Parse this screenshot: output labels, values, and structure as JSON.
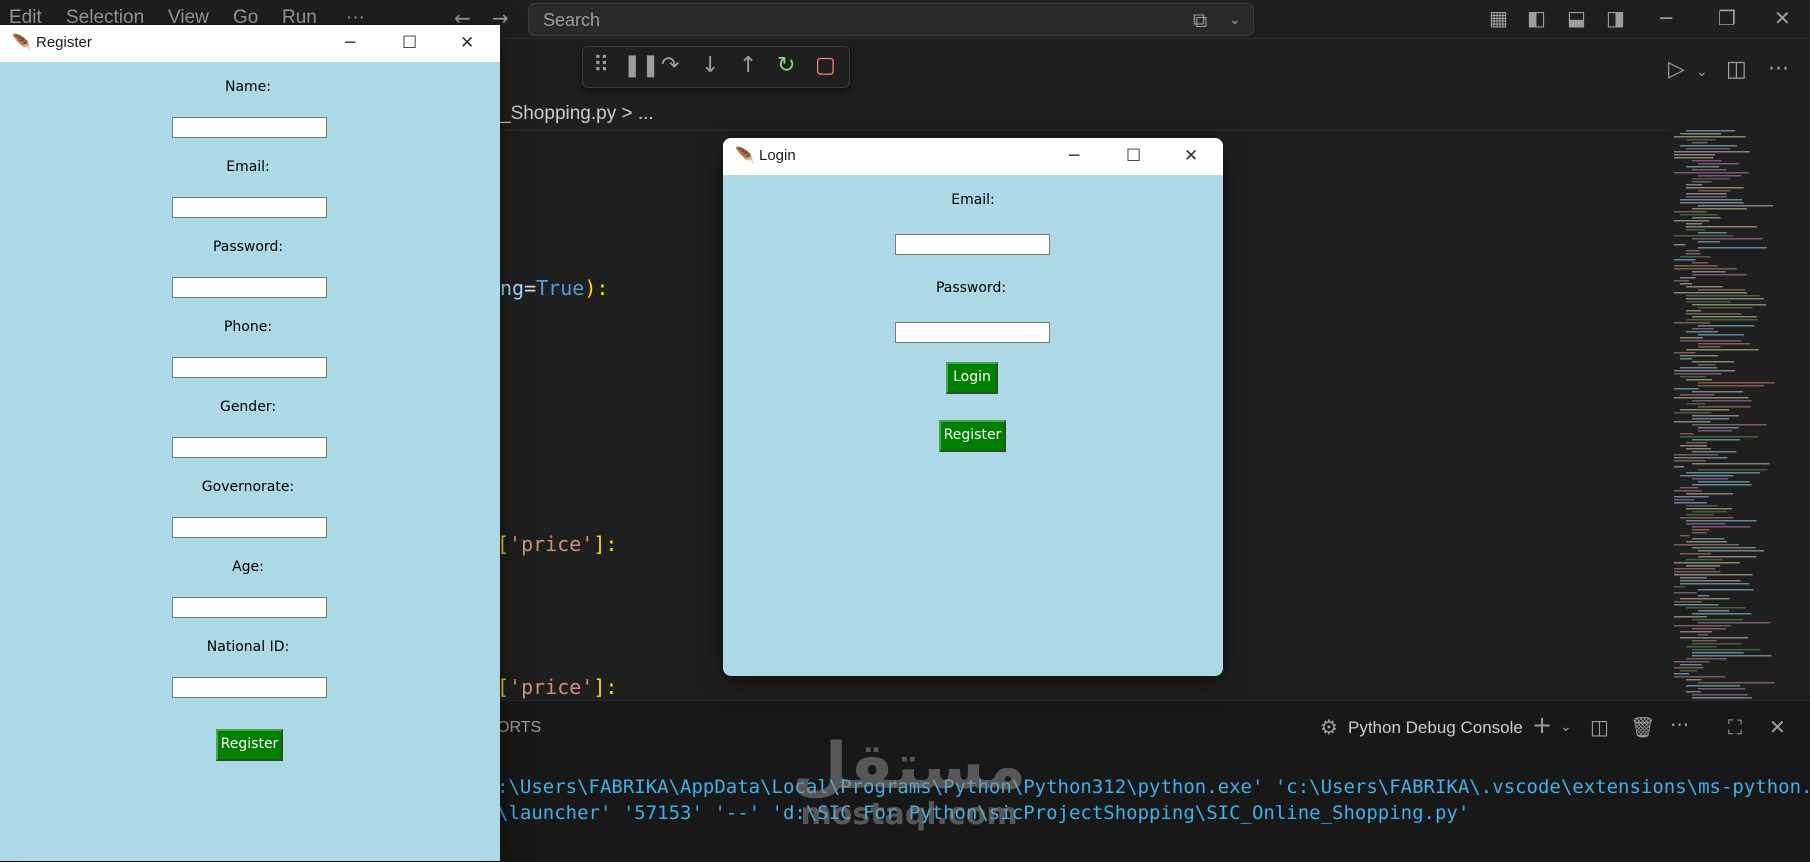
{
  "menu": [
    "Edit",
    "Selection",
    "View",
    "Go",
    "Run",
    "···"
  ],
  "search": {
    "placeholder": "Search"
  },
  "breadcrumb": "_Shopping.py > ...",
  "code": {
    "line1_a": "ng",
    "line1_eq": "=",
    "line1_true": "True",
    "line1_end": "):",
    "line2_a": "[",
    "line2_str": "'price'",
    "line2_end": "]:",
    "line3_a": "[",
    "line3_str": "'price'",
    "line3_end": "]:"
  },
  "panel": {
    "tab_partial": "ORTS",
    "console_label": "Python Debug Console",
    "terminal_line1": ":\\Users\\FABRIKA\\AppData\\Local\\Programs\\Python\\Python312\\python.exe' 'c:\\Users\\FABRIKA\\.vscode\\extensions\\ms-python.de",
    "terminal_line2": "\\launcher' '57153' '--' 'd:\\SIC For Python\\sicProjectShopping\\SIC_Online_Shopping.py'"
  },
  "watermark": {
    "arabic": "مستقل",
    "latin": "mostaql.com"
  },
  "register_window": {
    "title": "Register",
    "fields": [
      "Name:",
      "Email:",
      "Password:",
      "Phone:",
      "Gender:",
      "Governorate:",
      "Age:",
      "National ID:"
    ],
    "button": "Register"
  },
  "login_window": {
    "title": "Login",
    "fields": [
      "Email:",
      "Password:"
    ],
    "login_button": "Login",
    "register_button": "Register"
  },
  "colors": {
    "tk_bg": "#add8e6",
    "button_green": "#008000",
    "terminal_text": "#3fb0e8"
  }
}
